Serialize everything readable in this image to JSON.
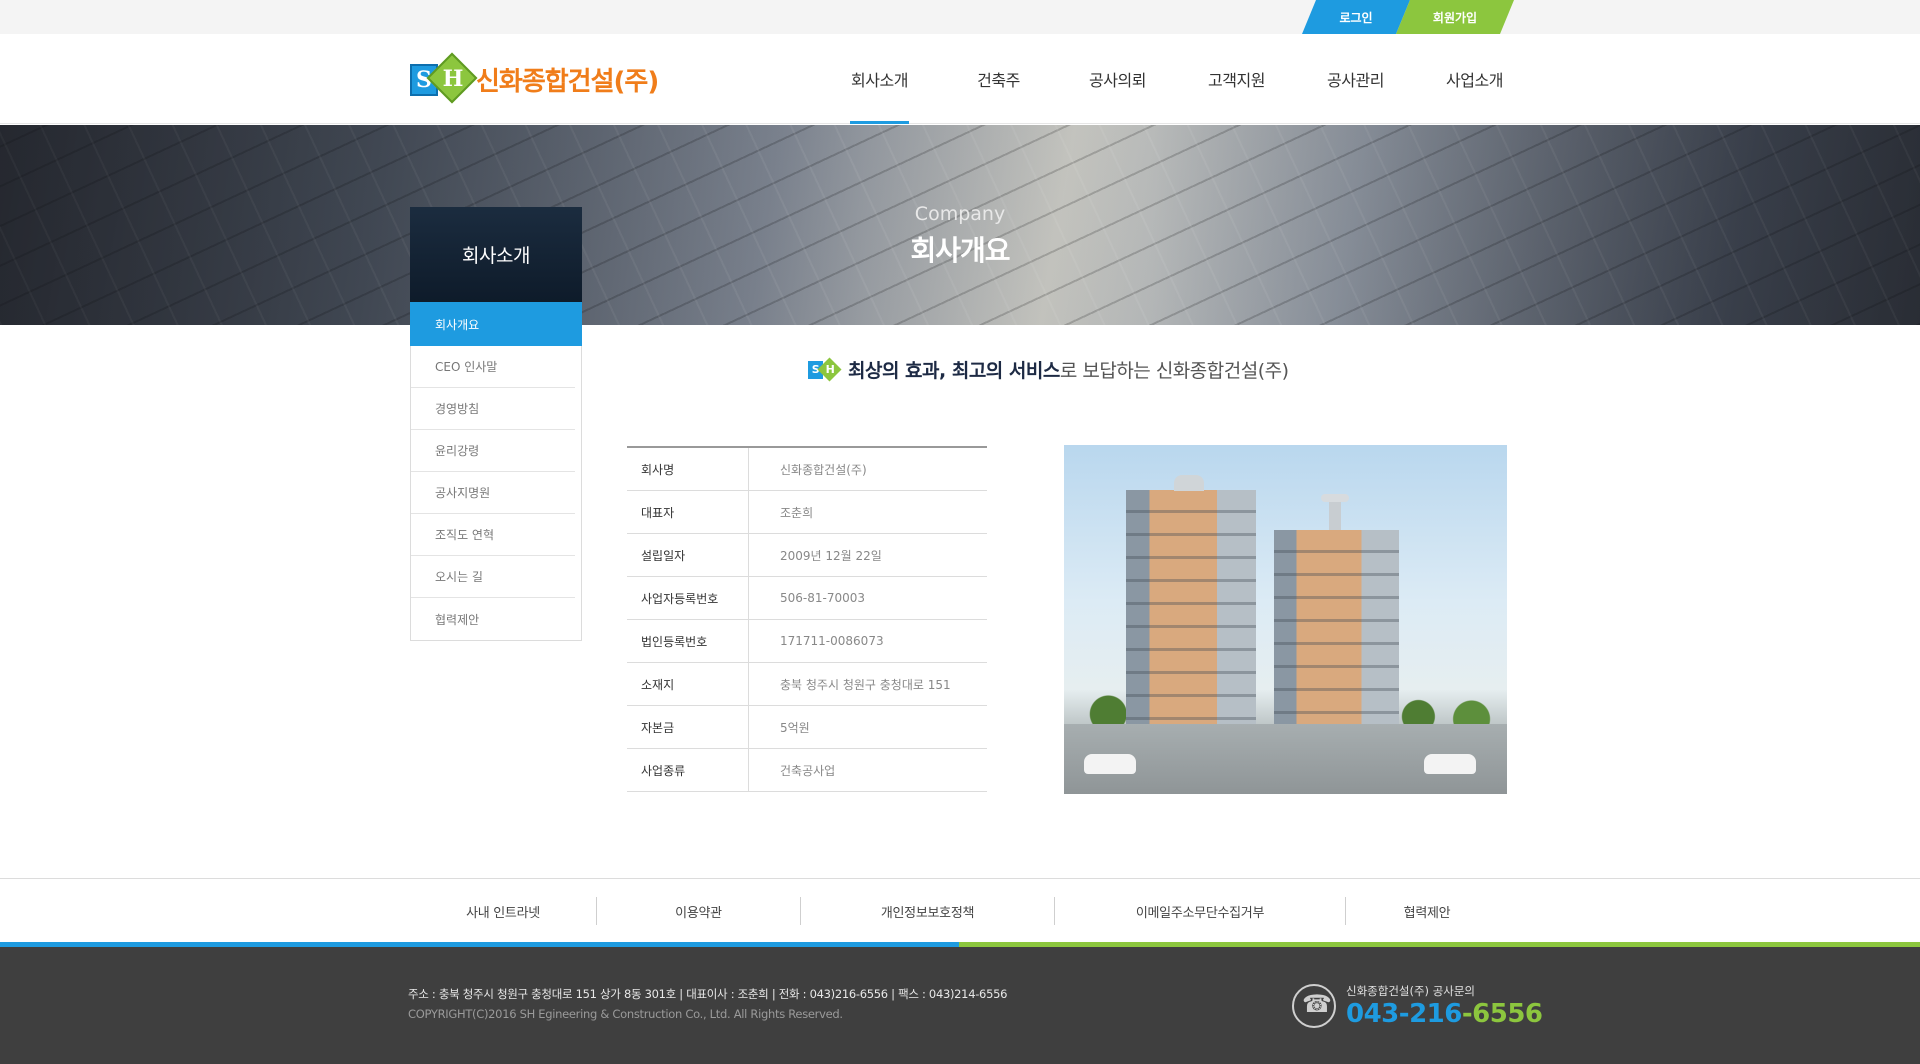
{
  "topbar": {
    "login": "로그인",
    "join": "회원가입"
  },
  "logo": {
    "text": "신화종합건설(주)",
    "mark_s": "S",
    "mark_h": "H"
  },
  "gnb": [
    "회사소개",
    "건축주",
    "공사의뢰",
    "고객지원",
    "공사관리",
    "사업소개"
  ],
  "banner": {
    "subtitle": "Company",
    "title": "회사개요"
  },
  "lnb": {
    "title": "회사소개",
    "items": [
      "회사개요",
      "CEO 인사말",
      "경영방침",
      "윤리강령",
      "공사지명원",
      "조직도 연혁",
      "오시는 길",
      "협력제안"
    ]
  },
  "slogan": {
    "bold": "최상의 효과, 최고의 서비스",
    "normal": "로 보답하는 신화종합건설(주)"
  },
  "info": [
    {
      "k": "회사명",
      "v": "신화종합건설(주)"
    },
    {
      "k": "대표자",
      "v": "조춘희"
    },
    {
      "k": "설립일자",
      "v": "2009년 12월 22일"
    },
    {
      "k": "사업자등록번호",
      "v": "506-81-70003"
    },
    {
      "k": "법인등록번호",
      "v": "171711-0086073"
    },
    {
      "k": "소재지",
      "v": "충북 청주시 청원구 충청대로 151"
    },
    {
      "k": "자본금",
      "v": "5억원"
    },
    {
      "k": "사업종류",
      "v": "건축공사업"
    }
  ],
  "footlinks": [
    "사내 인트라넷",
    "이용약관",
    "개인정보보호정책",
    "이메일주소무단수집거부",
    "협력제안"
  ],
  "footer": {
    "addr": "주소 : 충북 청주시 청원구 충청대로 151 상가 8동 301호  |  대표이사 : 조춘희  |  전화 : 043)216-6556  |  팩스 : 043)214-6556",
    "copy": "COPYRIGHT(C)2016  SH Egineering & Construction  Co., Ltd. All Rights Reserved.",
    "call_label": "신화종합건설(주) 공사문의",
    "call_num_a": "043-216",
    "call_num_b": "-6556"
  },
  "colors": {
    "blue": "#1e9be0",
    "green": "#8cc63e",
    "orange": "#f07d1a",
    "footer": "#3f3f3f"
  }
}
